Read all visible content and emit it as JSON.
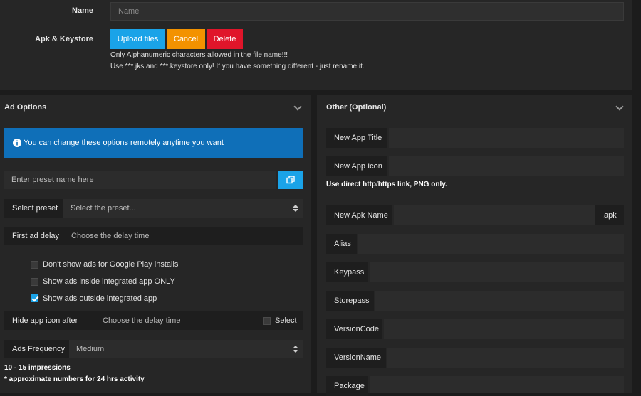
{
  "top": {
    "name_label": "Name",
    "name_placeholder": "Name",
    "apk_label": "Apk & Keystore",
    "upload_label": "Upload files",
    "cancel_label": "Cancel",
    "delete_label": "Delete",
    "note1": "Only Alphanumeric characters allowed in the file name!!!",
    "note2": "Use ***.jks and ***.keystore only! If you have something different - just rename it."
  },
  "ad_options": {
    "title": "Ad Options",
    "info_text": "You can change these options remotely anytime you want",
    "preset_placeholder": "Enter preset name here",
    "select_preset_label": "Select preset",
    "select_preset_value": "Select the preset...",
    "first_ad_delay_label": "First ad delay",
    "first_ad_delay_placeholder": "Choose the delay time",
    "checks": [
      {
        "label": "Don't show ads for Google Play installs",
        "checked": false
      },
      {
        "label": "Show ads inside integrated app ONLY",
        "checked": false
      },
      {
        "label": "Show ads outside integrated app",
        "checked": true
      }
    ],
    "hide_icon_label": "Hide app icon after",
    "hide_icon_placeholder": "Choose the delay time",
    "hide_icon_select_label": "Select",
    "frequency_label": "Ads Frequency",
    "frequency_value": "Medium",
    "impressions": "10 - 15 impressions",
    "footnote": "* approximate numbers for 24 hrs activity"
  },
  "other": {
    "title": "Other (Optional)",
    "new_app_title_label": "New App Title",
    "new_app_icon_label": "New App Icon",
    "icon_note": "Use direct http/https link, PNG only.",
    "new_apk_name_label": "New Apk Name",
    "apk_suffix": ".apk",
    "alias_label": "Alias",
    "keypass_label": "Keypass",
    "storepass_label": "Storepass",
    "versioncode_label": "VersionCode",
    "versionname_label": "VersionName",
    "package_label": "Package"
  },
  "colors": {
    "upload": "#1aa3e8",
    "cancel": "#f39200",
    "delete": "#e0152a",
    "info": "#0f6fb8"
  }
}
